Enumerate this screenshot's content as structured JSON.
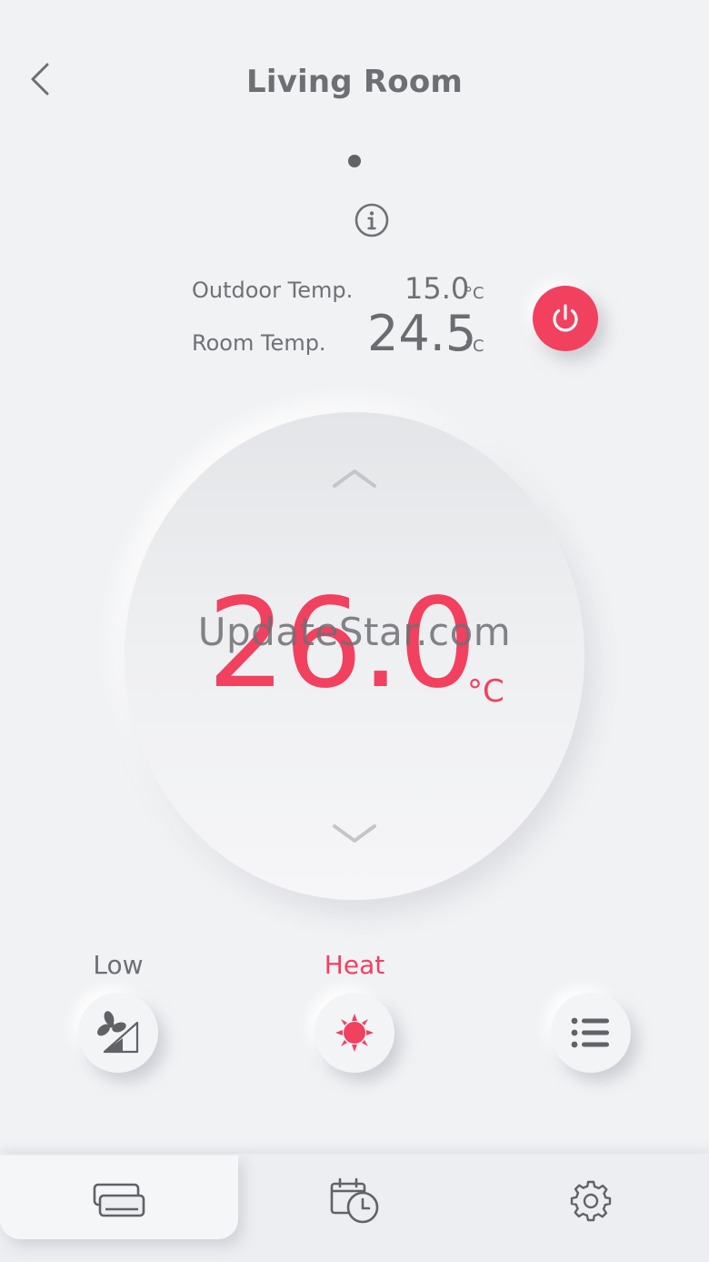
{
  "header": {
    "title": "Living Room",
    "back_icon": "chevron-left-icon"
  },
  "temps": {
    "outdoor_label": "Outdoor Temp.",
    "outdoor_value": "15.0",
    "room_label": "Room Temp.",
    "room_value": "24.5",
    "unit": "°C"
  },
  "dial": {
    "setpoint": "26.0",
    "unit": "°C"
  },
  "watermark": "UpdateStar.com",
  "controls": {
    "fan_label": "Low",
    "mode_label": "Heat"
  },
  "colors": {
    "accent": "#f2405f",
    "background": "#f1f2f4",
    "text": "#6e6f73"
  },
  "icons": {
    "power": "power-icon",
    "info": "info-icon",
    "fan": "fan-speed-icon",
    "mode": "sun-heat-icon",
    "menu": "list-menu-icon",
    "nav": [
      "ac-unit-icon",
      "schedule-icon",
      "gear-icon"
    ]
  }
}
